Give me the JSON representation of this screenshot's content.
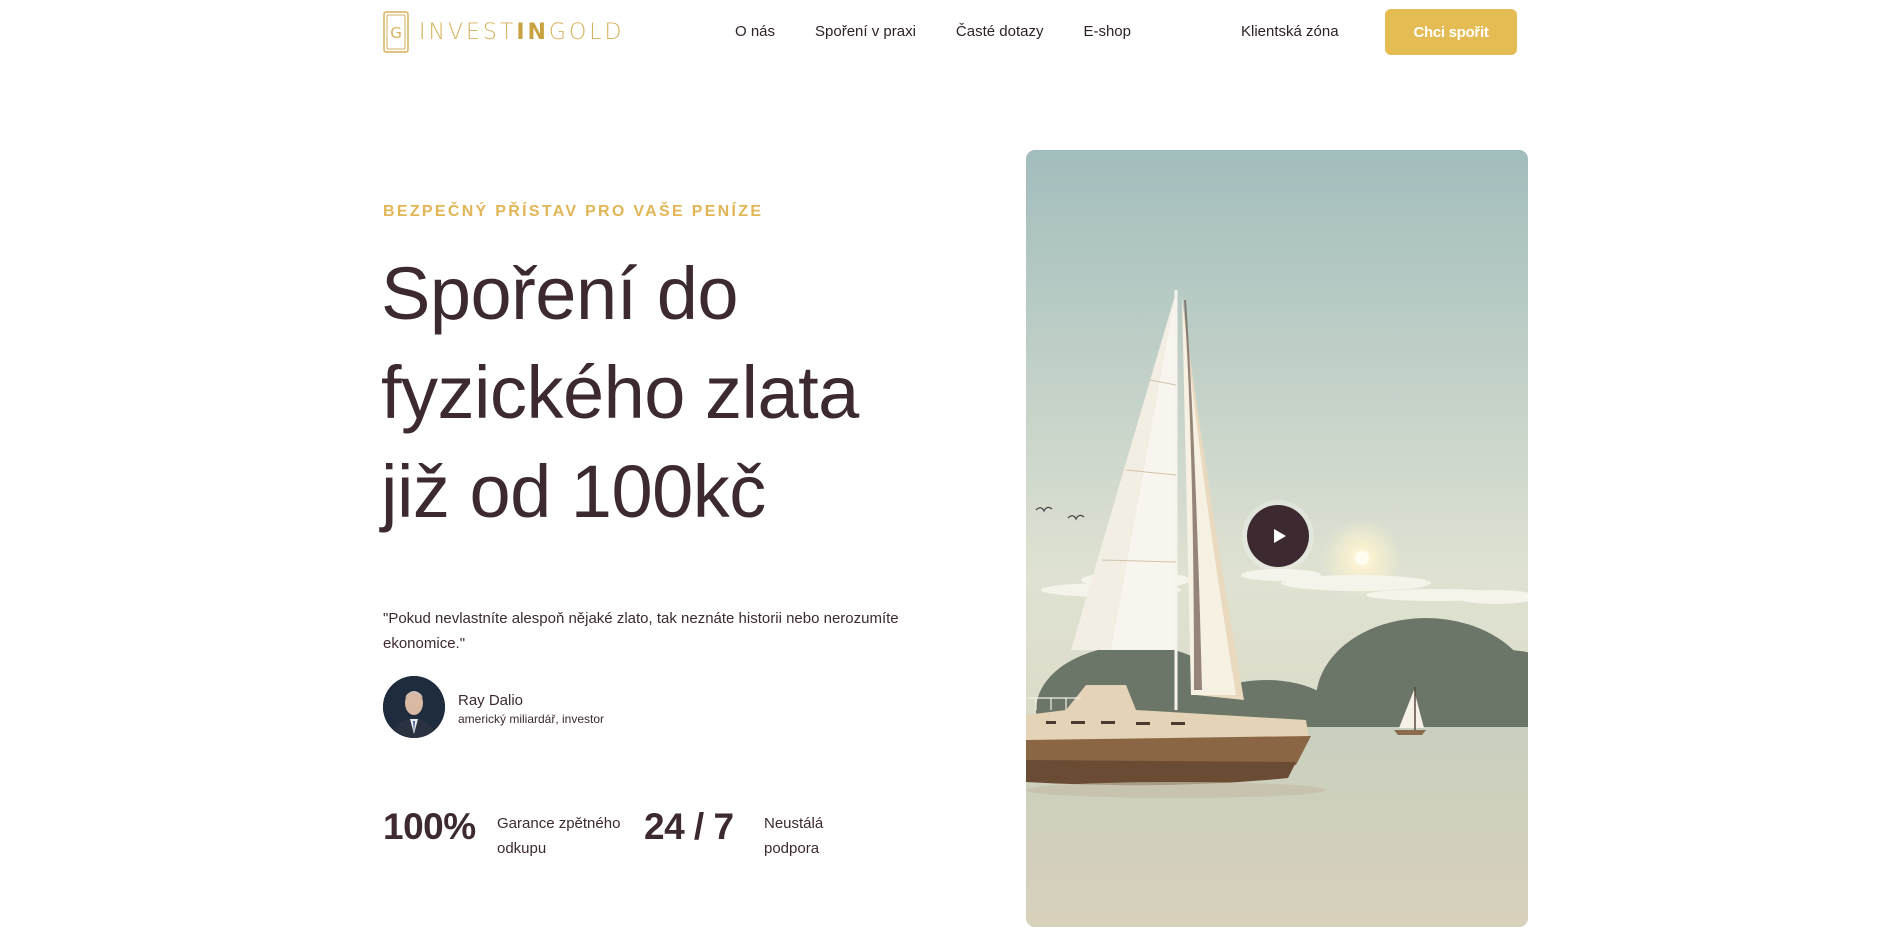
{
  "header": {
    "logo": {
      "text_light": "INVEST",
      "text_bold": "IN",
      "text_end": "GOLD",
      "icon": "logo-g-icon"
    },
    "nav": [
      {
        "label": "O nás"
      },
      {
        "label": "Spoření v praxi"
      },
      {
        "label": "Časté dotazy"
      },
      {
        "label": "E-shop"
      }
    ],
    "client_zone": "Klientská zóna",
    "cta": "Chci spořit"
  },
  "hero": {
    "eyebrow": "BEZPEČNÝ PŘÍSTAV PRO VAŠE PENÍZE",
    "headline": "Spoření do fyzického zlata již od 100kč",
    "quote": "\"Pokud nevlastníte alespoň nějaké zlato, tak neznáte historii nebo nerozumíte ekonomice.\"",
    "author": {
      "name": "Ray Dalio",
      "role": "americký miliardář, investor"
    },
    "stats": [
      {
        "value": "100%",
        "label": "Garance zpětného odkupu"
      },
      {
        "value": "24 / 7",
        "label": "Neustálá podpora"
      }
    ],
    "video": {
      "icon": "play-icon"
    }
  },
  "colors": {
    "accent": "#e5bc53",
    "text": "#3d2a31",
    "eyebrow": "#e2b656"
  }
}
